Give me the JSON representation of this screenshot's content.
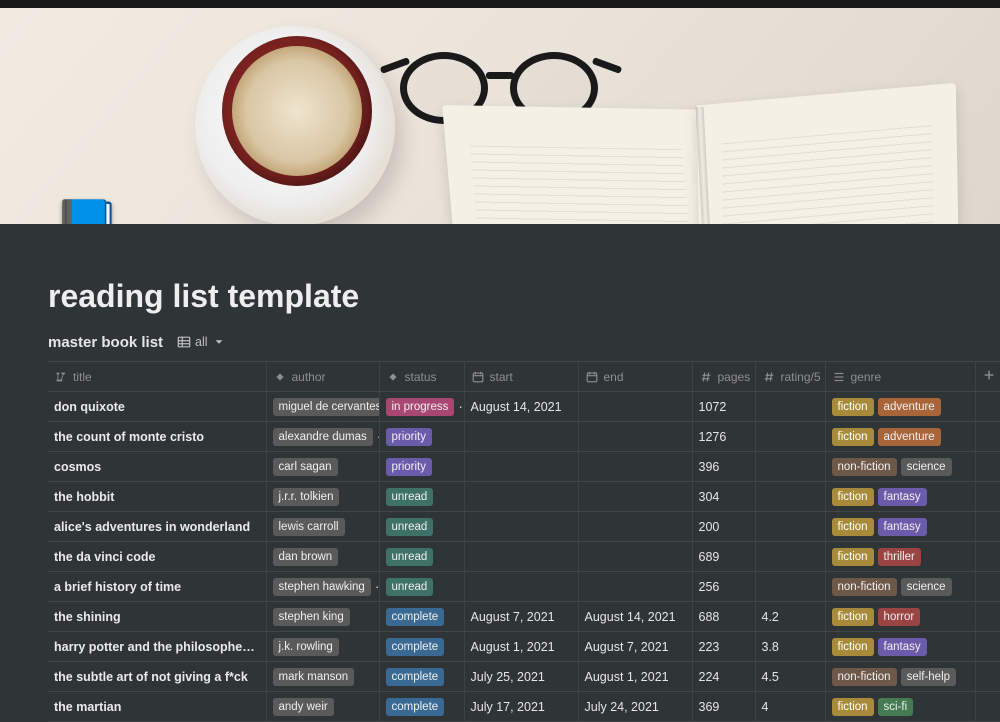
{
  "page": {
    "icon": "📘",
    "title": "reading list template"
  },
  "database": {
    "title": "master book list",
    "view_label": "all"
  },
  "columns": {
    "title": "title",
    "author": "author",
    "status": "status",
    "start": "start",
    "end": "end",
    "pages": "pages",
    "rating": "rating/5",
    "genre": "genre"
  },
  "tag_colors": {
    "author": "gray",
    "status": {
      "in progress": "pink",
      "priority": "purple",
      "unread": "teal",
      "complete": "blue"
    },
    "genre": {
      "fiction": "yellow",
      "adventure": "orange",
      "non-fiction": "brown",
      "science": "gray",
      "fantasy": "purple",
      "thriller": "red",
      "horror": "red",
      "self-help": "gray",
      "sci-fi": "green"
    }
  },
  "rows": [
    {
      "title": "don quixote",
      "author": "miguel de cervantes",
      "status": "in progress",
      "start": "August 14, 2021",
      "end": "",
      "pages": "1072",
      "rating": "",
      "genre": [
        "fiction",
        "adventure"
      ]
    },
    {
      "title": "the count of monte cristo",
      "author": "alexandre dumas",
      "status": "priority",
      "start": "",
      "end": "",
      "pages": "1276",
      "rating": "",
      "genre": [
        "fiction",
        "adventure"
      ]
    },
    {
      "title": "cosmos",
      "author": "carl sagan",
      "status": "priority",
      "start": "",
      "end": "",
      "pages": "396",
      "rating": "",
      "genre": [
        "non-fiction",
        "science"
      ]
    },
    {
      "title": "the hobbit",
      "author": "j.r.r. tolkien",
      "status": "unread",
      "start": "",
      "end": "",
      "pages": "304",
      "rating": "",
      "genre": [
        "fiction",
        "fantasy"
      ]
    },
    {
      "title": "alice's adventures in wonderland",
      "author": "lewis carroll",
      "status": "unread",
      "start": "",
      "end": "",
      "pages": "200",
      "rating": "",
      "genre": [
        "fiction",
        "fantasy"
      ]
    },
    {
      "title": "the da vinci code",
      "author": "dan brown",
      "status": "unread",
      "start": "",
      "end": "",
      "pages": "689",
      "rating": "",
      "genre": [
        "fiction",
        "thriller"
      ]
    },
    {
      "title": "a brief history of time",
      "author": "stephen hawking",
      "status": "unread",
      "start": "",
      "end": "",
      "pages": "256",
      "rating": "",
      "genre": [
        "non-fiction",
        "science"
      ]
    },
    {
      "title": "the shining",
      "author": "stephen king",
      "status": "complete",
      "start": "August 7, 2021",
      "end": "August 14, 2021",
      "pages": "688",
      "rating": "4.2",
      "genre": [
        "fiction",
        "horror"
      ]
    },
    {
      "title": "harry potter and the philosopher's stone",
      "author": "j.k. rowling",
      "status": "complete",
      "start": "August 1, 2021",
      "end": "August 7, 2021",
      "pages": "223",
      "rating": "3.8",
      "genre": [
        "fiction",
        "fantasy"
      ]
    },
    {
      "title": "the subtle art of not giving a f*ck",
      "author": "mark manson",
      "status": "complete",
      "start": "July 25, 2021",
      "end": "August 1, 2021",
      "pages": "224",
      "rating": "4.5",
      "genre": [
        "non-fiction",
        "self-help"
      ]
    },
    {
      "title": "the martian",
      "author": "andy weir",
      "status": "complete",
      "start": "July 17, 2021",
      "end": "July 24, 2021",
      "pages": "369",
      "rating": "4",
      "genre": [
        "fiction",
        "sci-fi"
      ]
    }
  ]
}
